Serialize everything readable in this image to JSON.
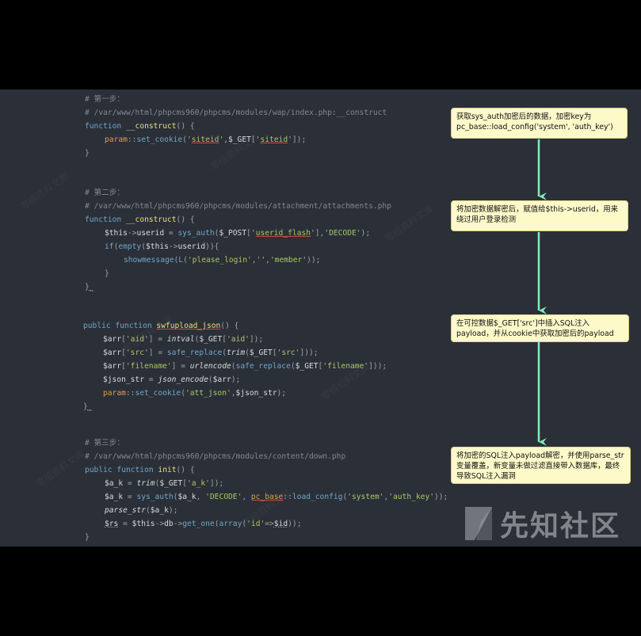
{
  "code": {
    "step1_comment": "# 第一步：",
    "step1_path": "# /var/www/html/phpcms960/phpcms/modules/wap/index.php:__construct",
    "step2_comment": "# 第二步：",
    "step2_path": "# /var/www/html/phpcms960/phpcms/modules/attachment/attachments.php",
    "step3_comment": "# 第三步：",
    "step3_path": "# /var/www/html/phpcms960/phpcms/modules/content/down.php"
  },
  "notes": {
    "note1": "获取sys_auth加密后的数据，加密key为pc_base::load_config('system', 'auth_key')",
    "note2": "将加密数据解密后，赋值给$this->userid，用来绕过用户登录检测",
    "note3": "在可控数据$_GET['src']中插入SQL注入payload，并从cookie中获取加密后的payload",
    "note4": "将加密的SQL注入payload解密，并使用parse_str变量覆盖，新变量未做过滤直接带入数据库，最终导致SQL注入漏洞"
  },
  "logo": {
    "text": "先知社区",
    "icon": "xianzhi-logo-icon"
  },
  "colors": {
    "editor_bg": "#2b2f38",
    "note_bg": "#fdf9c9",
    "arrow": "#7ef0b4"
  }
}
